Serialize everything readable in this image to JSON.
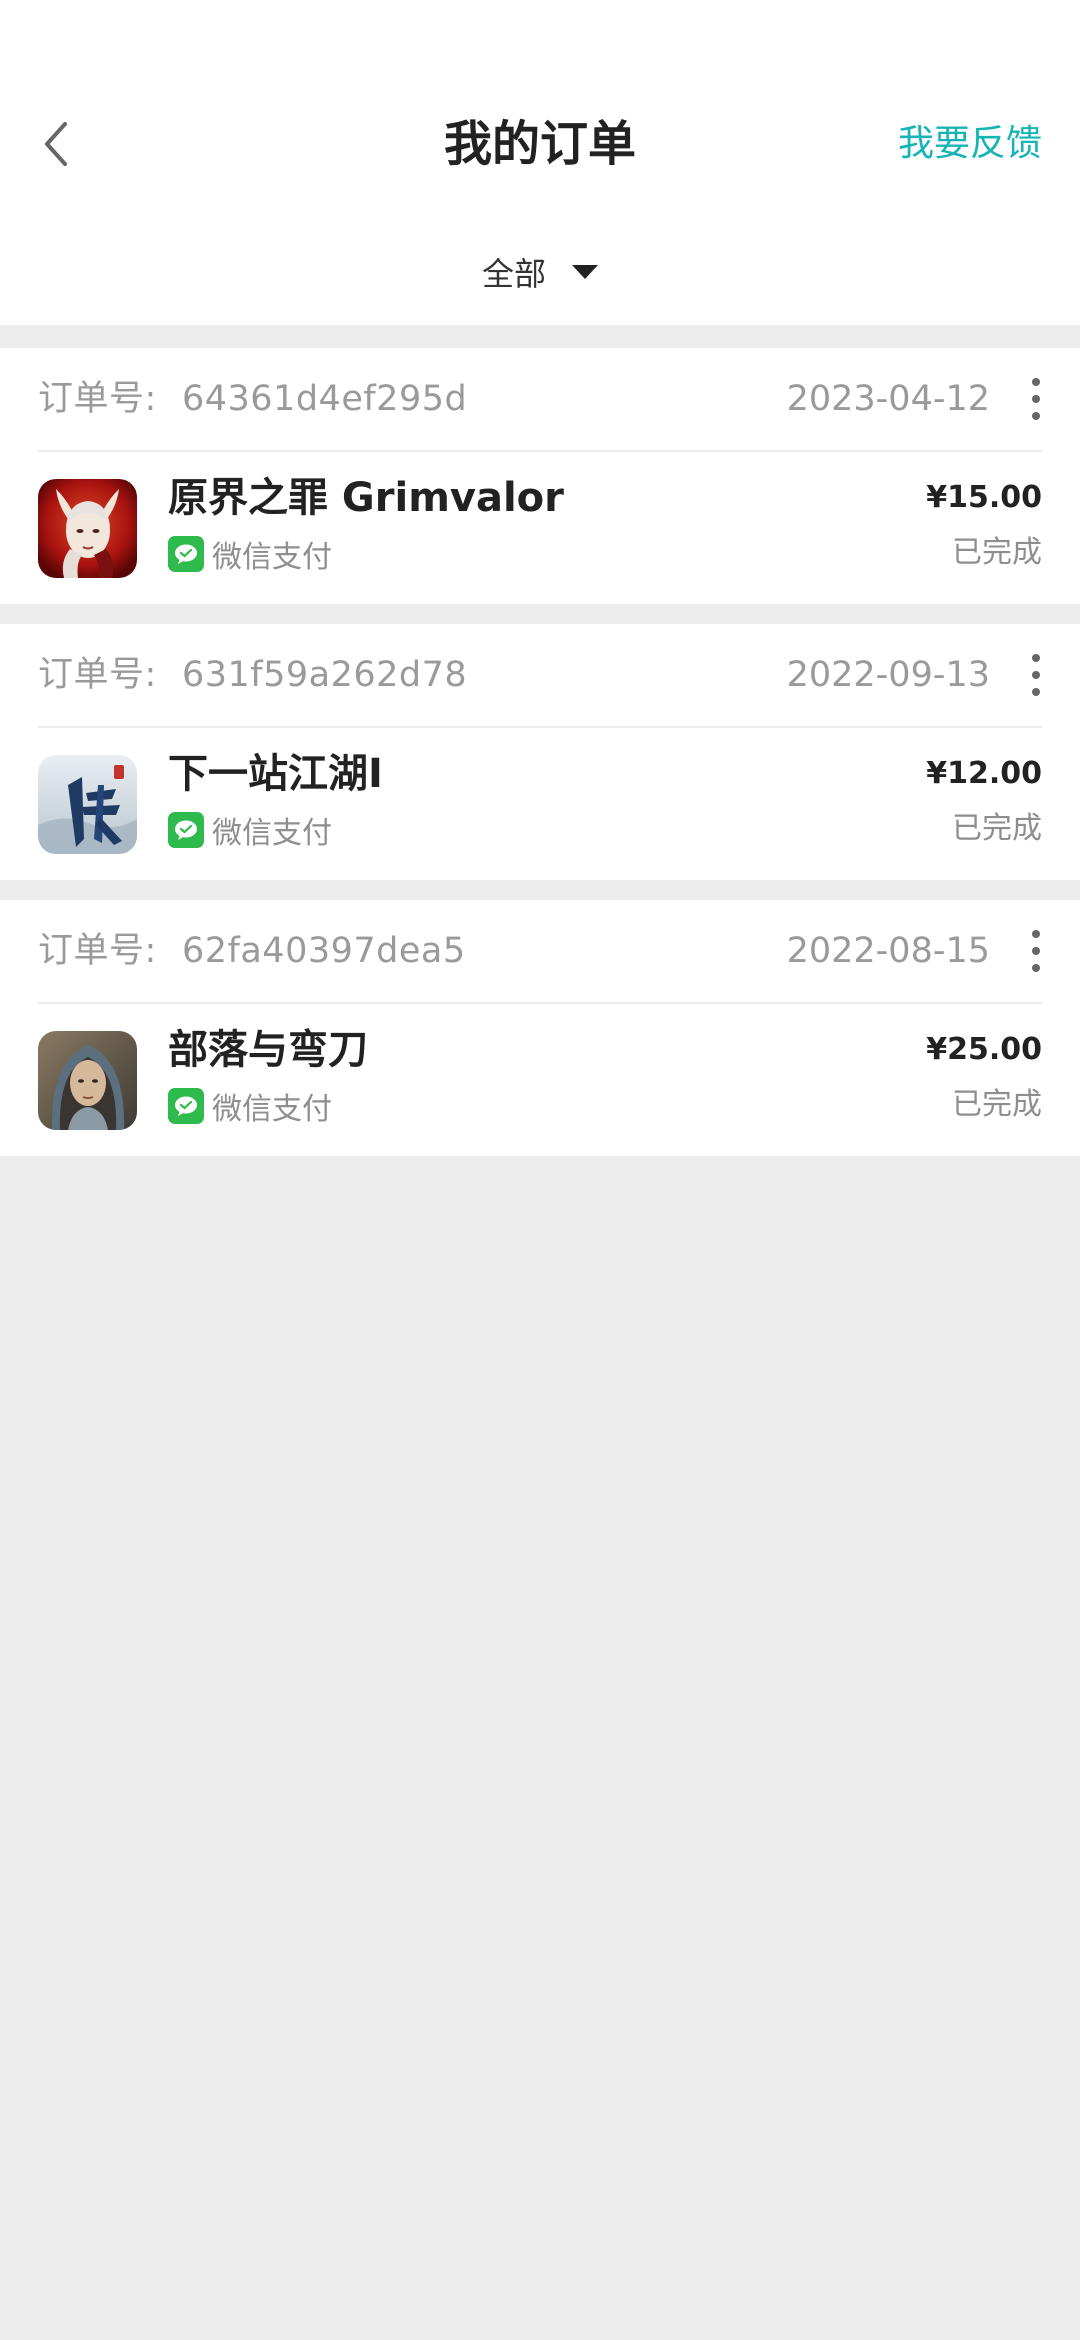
{
  "header": {
    "title": "我的订单",
    "feedback_label": "我要反馈"
  },
  "filter": {
    "selected": "全部"
  },
  "order_no_label": "订单号:",
  "orders": [
    {
      "order_no": "64361d4ef295d",
      "date": "2023-04-12",
      "game": "原界之罪 Grimvalor",
      "payment": "微信支付",
      "price": "¥15.00",
      "status": "已完成"
    },
    {
      "order_no": "631f59a262d78",
      "date": "2022-09-13",
      "game": "下一站江湖I",
      "payment": "微信支付",
      "price": "¥12.00",
      "status": "已完成"
    },
    {
      "order_no": "62fa40397dea5",
      "date": "2022-08-15",
      "game": "部落与弯刀",
      "payment": "微信支付",
      "price": "¥25.00",
      "status": "已完成"
    }
  ],
  "colors": {
    "accent": "#17b4b6",
    "wechat_green": "#2fba4e",
    "page_bg": "#ededed"
  }
}
